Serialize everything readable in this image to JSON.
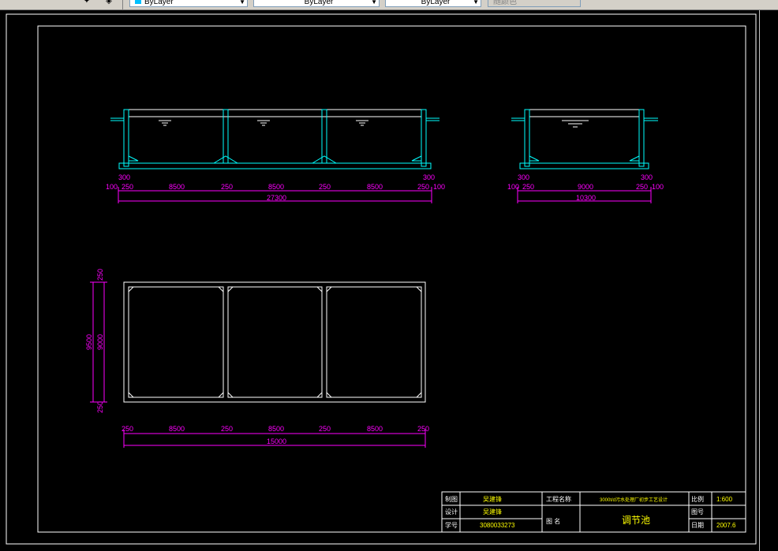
{
  "toolbar": {
    "linetype_value": "ByLayer",
    "lineweight_value": "ByLayer",
    "plotstyle_value": "ByLayer",
    "color_value": "随颜色"
  },
  "section_a": {
    "level_top": "300",
    "dims_row": [
      "100",
      "250",
      "8500",
      "250",
      "8500",
      "250",
      "8500",
      "250",
      "100"
    ],
    "dim_right_top": "300",
    "total": "27300"
  },
  "section_b": {
    "level_top_left": "300",
    "level_top_right": "300",
    "dims_row": [
      "100",
      "250",
      "9000",
      "250",
      "100"
    ],
    "total": "10300"
  },
  "plan": {
    "dims_bottom": [
      "250",
      "8500",
      "250",
      "8500",
      "250",
      "8500",
      "250"
    ],
    "total_bottom": "15000",
    "dims_left_outer": "9500",
    "dims_left": [
      "250",
      "9000",
      "250"
    ]
  },
  "title_block": {
    "row1": {
      "label": "制图",
      "name": "吴建锋",
      "project_label": "工程名称",
      "project": "3000t/d污水处理厂初步工艺设计",
      "scale_label": "比例",
      "scale": "1:600"
    },
    "row2": {
      "label": "设计",
      "name": "吴建锋",
      "drawing_label": "图 名",
      "drawing_title": "调节池",
      "no_label": "图号",
      "no": ""
    },
    "row3": {
      "label": "学号",
      "id": "3080033273",
      "date_label": "日期",
      "date": "2007.6"
    }
  },
  "colors": {
    "outline": "#ffffff",
    "wall": "#00ffff",
    "dim": "#ff00ff",
    "text_yellow": "#ffff00",
    "border": "#ffffff"
  }
}
